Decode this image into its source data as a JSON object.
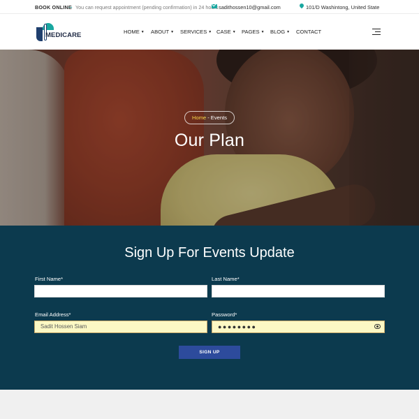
{
  "topbar": {
    "book_label": "BOOK ONLINE",
    "book_note": "You can request appointment (pending confirmation) in 24 hours",
    "email": "sadithossen10@gmail.com",
    "address": "101/D Washintong, United State"
  },
  "header": {
    "logo_text": "MEDICARE",
    "nav": [
      "HOME",
      "ABOUT",
      "SERVICES",
      "CASE",
      "PAGES",
      "BLOG",
      "CONTACT"
    ]
  },
  "hero": {
    "breadcrumb_home": "Home",
    "breadcrumb_sep": "-",
    "breadcrumb_current": "Events",
    "title": "Our Plan"
  },
  "form": {
    "title": "Sign Up For Events Update",
    "first_name_label": "First Name*",
    "first_name_value": "",
    "last_name_label": "Last Name*",
    "last_name_value": "",
    "email_label": "Email Address*",
    "email_value": "Sadit Hossen Siam",
    "password_label": "Password*",
    "password_value": "●●●●●●●●",
    "submit_label": "SIGN UP"
  },
  "colors": {
    "accent": "#19a7a0",
    "form_bg": "#0c3a4e",
    "button": "#2d4b9c",
    "breadcrumb_home": "#f6d44a"
  }
}
